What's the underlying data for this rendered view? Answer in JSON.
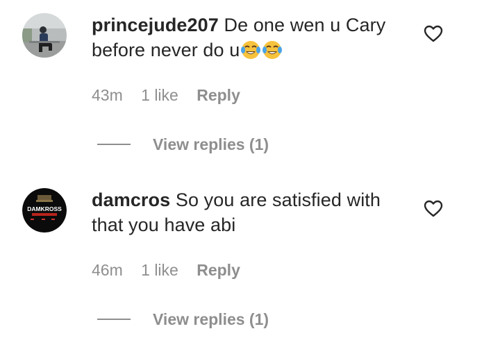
{
  "comments": [
    {
      "username": "princejude207",
      "text": "De one wen u Cary before never do u",
      "emojis": [
        "face-with-tears-of-joy",
        "face-with-tears-of-joy"
      ],
      "time": "43m",
      "likes": "1 like",
      "reply_label": "Reply",
      "view_replies_label": "View replies (1)"
    },
    {
      "username": "damcros",
      "text": "So you are satisfied with that you have abi",
      "avatar_text": "DAMKROSS",
      "time": "46m",
      "likes": "1 like",
      "reply_label": "Reply",
      "view_replies_label": "View replies (1)"
    }
  ]
}
